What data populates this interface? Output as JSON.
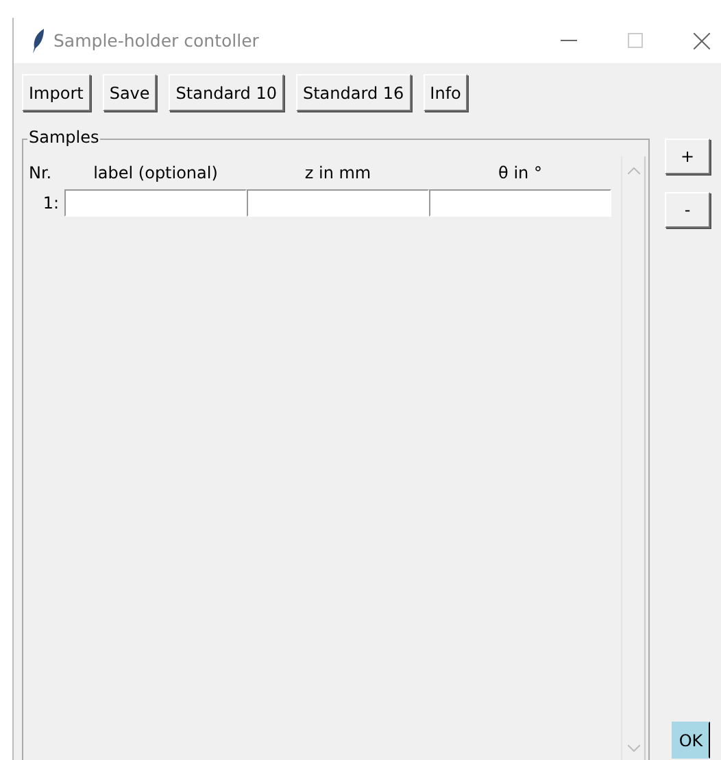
{
  "window": {
    "title": "Sample-holder contoller"
  },
  "toolbar": [
    "Import",
    "Save",
    "Standard 10",
    "Standard 16",
    "Info"
  ],
  "samples": {
    "title": "Samples",
    "columns": [
      "Nr.",
      "label (optional)",
      "z in mm",
      "θ in °"
    ],
    "rows": [
      {
        "number": "1:"
      }
    ]
  },
  "side_buttons": [
    "+",
    "-"
  ],
  "ok_button": "OK"
}
